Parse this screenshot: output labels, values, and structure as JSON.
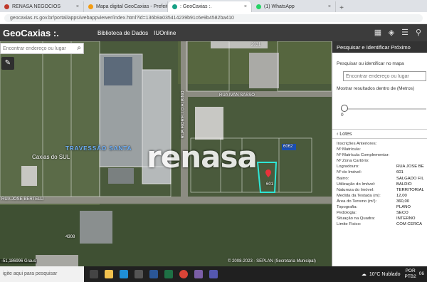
{
  "browser": {
    "tabs": [
      {
        "title": "RENASA NEGOCIOS",
        "color": "#c0392b"
      },
      {
        "title": "Mapa digital GeoCaxias - Prefeit",
        "color": "#f39c12"
      },
      {
        "title": ": GeoCaxias :.",
        "color": "#16a085"
      },
      {
        "title": "(1) WhatsApp",
        "color": "#25d366"
      }
    ],
    "url": "geocaxias.rs.gov.br/portal/apps/webappviewer/index.html?id=136b9a035414239b91c6e9b4582ba410"
  },
  "app": {
    "logo": "GeoCaxias :.",
    "links": [
      "Biblioteca de Dados",
      "IUOnline"
    ],
    "icons": [
      "grid-icon",
      "layers-icon",
      "list-icon",
      "share-icon"
    ]
  },
  "map": {
    "search_placeholder": "Encontrar endereço ou lugar",
    "labels": [
      {
        "text": "TRAVESSÃO SANTA",
        "color": "#6fb3ff"
      },
      {
        "text": "Caxias do SUL",
        "color": "#fff"
      },
      {
        "text": "RUA IVAN SASSO",
        "color": "#fff"
      },
      {
        "text": "RUA JOSE BERTELLI",
        "color": "#fff"
      },
      {
        "text": "RUA FIORELLO ALBINO",
        "color": "#fff"
      },
      {
        "text": "2031",
        "color": "#fff"
      },
      {
        "text": "6062",
        "color": "#fff"
      },
      {
        "text": "4308",
        "color": "#fff"
      },
      {
        "text": "601",
        "color": "#fff"
      }
    ],
    "watermark": "renasa",
    "coords": "-51,186996 Graus",
    "footer": "© 2008-2023 - SEPLAN (Secretaria Municipal)"
  },
  "panel": {
    "title": "Pesquisar e Identificar Próximo",
    "search_label": "Pesquisar ou identificar no mapa",
    "search_placeholder": "Encontrar endereço ou lugar",
    "radius_label": "Mostrar resultados dentro de (Metros)",
    "radius_value": "0",
    "slider_fraction": 0.0,
    "section": "Lotes",
    "attributes": [
      {
        "k": "Inscrições Anteriores:",
        "v": ""
      },
      {
        "k": "Nº Matrícula:",
        "v": ""
      },
      {
        "k": "Nº Matrícula Complementar:",
        "v": ""
      },
      {
        "k": "Nº Zona Cartório:",
        "v": ""
      },
      {
        "k": "Logradouro:",
        "v": "RUA JOSE BE"
      },
      {
        "k": "Nº do Imóvel:",
        "v": "601"
      },
      {
        "k": "Bairro:",
        "v": "SALGADO FIL"
      },
      {
        "k": "Utilização do Imóvel:",
        "v": "BALDIO"
      },
      {
        "k": "Natureza do Imóvel:",
        "v": "TERRITORIAL"
      },
      {
        "k": "Medida da Testada (m):",
        "v": "12,00"
      },
      {
        "k": "Área do Terreno (m²):",
        "v": "360,00"
      },
      {
        "k": "Topografia:",
        "v": "PLANO"
      },
      {
        "k": "Pedologia:",
        "v": "SECO"
      },
      {
        "k": "Situação na Quadra:",
        "v": "INTERNO"
      },
      {
        "k": "Limite Fisico:",
        "v": "COM CERCA"
      }
    ]
  },
  "taskbar": {
    "search_placeholder": "igite aqui para pesquisar",
    "weather": "10°C  Nublado",
    "lang": "POR",
    "layout": "PTB2",
    "time": "06"
  }
}
